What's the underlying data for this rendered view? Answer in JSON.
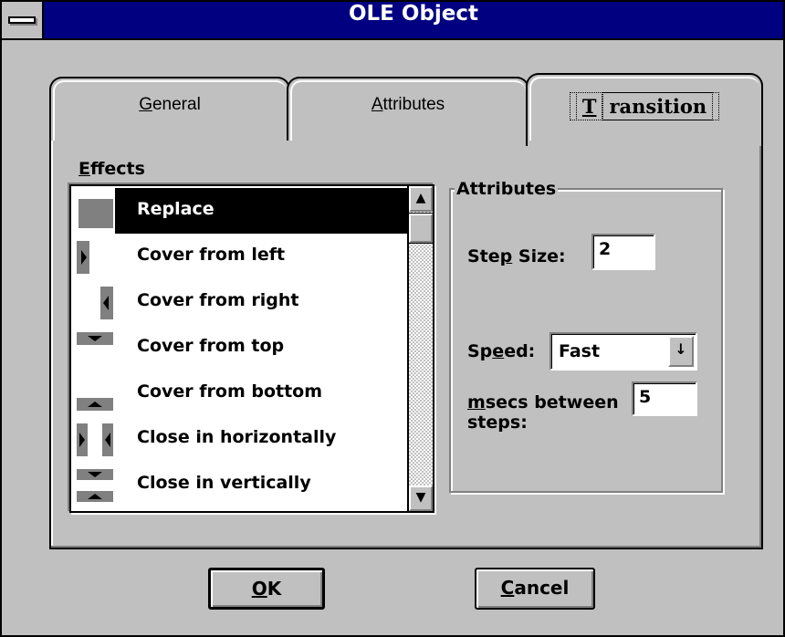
{
  "window": {
    "title": "OLE Object"
  },
  "tabs": [
    {
      "label_pre": "",
      "label_ul": "G",
      "label_post": "eneral"
    },
    {
      "label_pre": "",
      "label_ul": "A",
      "label_post": "ttributes"
    },
    {
      "label_pre": "",
      "label_ul": "T",
      "label_post": "ransition"
    }
  ],
  "effects": {
    "label_ul": "E",
    "label_post": "ffects",
    "selected": "Replace",
    "items": [
      {
        "label": "Replace",
        "icon": "replace-icon"
      },
      {
        "label": "Cover from left",
        "icon": "cover-left-icon"
      },
      {
        "label": "Cover from right",
        "icon": "cover-right-icon"
      },
      {
        "label": "Cover from top",
        "icon": "cover-top-icon"
      },
      {
        "label": "Cover from bottom",
        "icon": "cover-bottom-icon"
      },
      {
        "label": "Close in horizontally",
        "icon": "close-horizontal-icon"
      },
      {
        "label": "Close in vertically",
        "icon": "close-vertical-icon"
      }
    ],
    "scroll_up": "▲",
    "scroll_down": "▼"
  },
  "attributes": {
    "group_title": "Attributes",
    "step_size_pre": "Ste",
    "step_size_ul": "p",
    "step_size_post": " Size:",
    "step_size_value": "2",
    "speed_pre": "Sp",
    "speed_ul": "e",
    "speed_post": "ed:",
    "speed_value": "Fast",
    "msecs_ul": "m",
    "msecs_post": "secs between",
    "msecs_line2": "steps:",
    "msecs_value": "5"
  },
  "buttons": {
    "ok_ul": "O",
    "ok_post": "K",
    "cancel_ul": "C",
    "cancel_post": "ancel"
  },
  "colors": {
    "titlebar": "#000080",
    "face": "#c0c0c0",
    "selection": "#000000"
  }
}
